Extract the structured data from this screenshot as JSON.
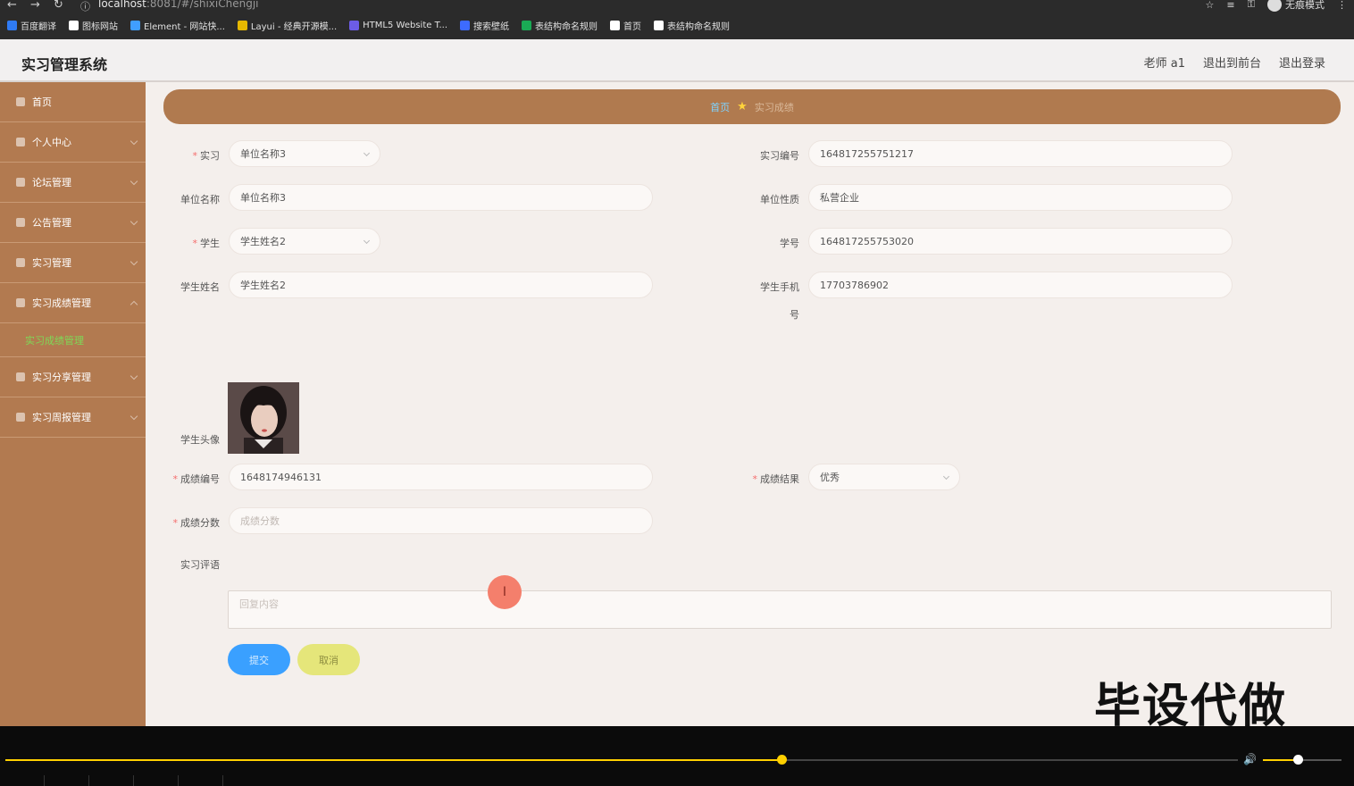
{
  "browser": {
    "url_host": "localhost",
    "url_rest": ":8081/#/shixiChengji",
    "incognito_label": "无痕模式",
    "bookmarks": [
      {
        "label": "百度翻译",
        "color": "#2f7bf5"
      },
      {
        "label": "图标网站",
        "color": "#ffffff"
      },
      {
        "label": "Element - 网站快...",
        "color": "#409eff"
      },
      {
        "label": "Layui - 经典开源模...",
        "color": "#e6b800"
      },
      {
        "label": "HTML5 Website T...",
        "color": "#6c5ce7"
      },
      {
        "label": "搜索壁纸",
        "color": "#3d6bff"
      },
      {
        "label": "表结构命名规则",
        "color": "#1aaa55"
      },
      {
        "label": "首页",
        "color": "#ffffff"
      },
      {
        "label": "表结构命名规则",
        "color": "#ffffff"
      }
    ]
  },
  "header": {
    "title": "实习管理系统",
    "user": "老师 a1",
    "to_front": "退出到前台",
    "logout": "退出登录"
  },
  "sidebar": {
    "items": [
      {
        "label": "首页"
      },
      {
        "label": "个人中心"
      },
      {
        "label": "论坛管理"
      },
      {
        "label": "公告管理"
      },
      {
        "label": "实习管理"
      },
      {
        "label": "实习成绩管理"
      },
      {
        "label": "实习分享管理"
      },
      {
        "label": "实习周报管理"
      }
    ],
    "active_sub": "实习成绩管理"
  },
  "breadcrumb": {
    "home": "首页",
    "current": "实习成绩"
  },
  "form": {
    "shixi_label": "实习",
    "shixi_value": "单位名称3",
    "shixi_no_label": "实习编号",
    "shixi_no_value": "164817255751217",
    "unit_name_label": "单位名称",
    "unit_name_value": "单位名称3",
    "unit_type_label": "单位性质",
    "unit_type_value": "私营企业",
    "student_label": "学生",
    "student_value": "学生姓名2",
    "student_no_label": "学号",
    "student_no_value": "164817255753020",
    "student_name_label": "学生姓名",
    "student_name_value": "学生姓名2",
    "student_phone_label_1": "学生手机",
    "student_phone_label_2": "号",
    "student_phone_value": "17703786902",
    "avatar_label": "学生头像",
    "score_no_label": "成绩编号",
    "score_no_value": "1648174946131",
    "result_label": "成绩结果",
    "result_value": "优秀",
    "score_label": "成绩分数",
    "score_placeholder": "成绩分数",
    "comment_label": "实习评语",
    "comment_placeholder": "回复内容",
    "submit": "提交",
    "cancel": "取消",
    "required_mark": "*"
  },
  "overlay": {
    "cursor_glyph": "I",
    "watermark": "毕设代做"
  },
  "player": {
    "progress": 0.63,
    "volume": 0.44
  }
}
